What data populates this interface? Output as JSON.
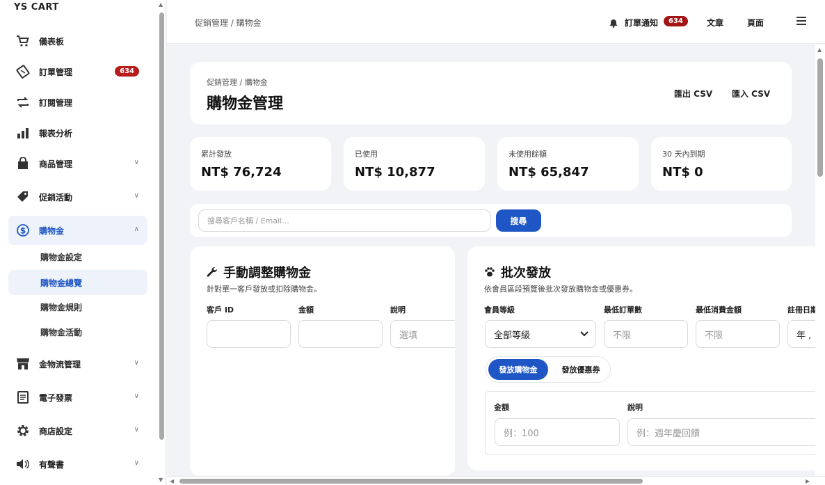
{
  "brand": "YS CART",
  "sidebar": {
    "items": [
      {
        "label": "儀表板",
        "icon": "cart-icon"
      },
      {
        "label": "訂單管理",
        "icon": "receipt-icon",
        "badge": "634"
      },
      {
        "label": "訂閱管理",
        "icon": "repeat-icon"
      },
      {
        "label": "報表分析",
        "icon": "bar-chart-icon"
      },
      {
        "label": "商品管理",
        "icon": "shop-bag-icon"
      },
      {
        "label": "促銷活動",
        "icon": "tag-icon"
      },
      {
        "label": "購物金",
        "icon": "dollar-circle-icon"
      },
      {
        "label": "金物流管理",
        "icon": "store-icon"
      },
      {
        "label": "電子發票",
        "icon": "invoice-icon"
      },
      {
        "label": "商店設定",
        "icon": "gear-icon"
      },
      {
        "label": "有聲書",
        "icon": "speaker-icon"
      }
    ],
    "sub_items": [
      "購物金設定",
      "購物金總覽",
      "購物金規則",
      "購物金活動"
    ]
  },
  "topbar": {
    "breadcrumb": "促銷管理 / 購物金",
    "notify_label": "訂單通知",
    "notify_count": "634",
    "articles": "文章",
    "pages": "頁面"
  },
  "header": {
    "breadcrumb": "促銷管理 / 購物金",
    "title": "購物金管理",
    "export_csv": "匯出 CSV",
    "import_csv": "匯入 CSV"
  },
  "stats": [
    {
      "label": "累計發放",
      "value": "NT$ 76,724"
    },
    {
      "label": "已使用",
      "value": "NT$ 10,877"
    },
    {
      "label": "未使用餘額",
      "value": "NT$ 65,847"
    },
    {
      "label": "30 天內到期",
      "value": "NT$ 0"
    }
  ],
  "search": {
    "placeholder": "搜尋客戶名稱 / Email...",
    "button": "搜尋"
  },
  "manual": {
    "title": "手動調整購物金",
    "desc": "針對單一客戶發放或扣除購物金。",
    "customer_id_label": "客戶 ID",
    "amount_label": "金額",
    "note_label": "說明",
    "note_placeholder": "選填"
  },
  "batch": {
    "title": "批次發放",
    "desc": "依會員區段預覽後批次發放購物金或優惠券。",
    "level_label": "會員等級",
    "level_value": "全部等級",
    "min_orders_label": "最低訂單數",
    "min_orders_placeholder": "不限",
    "min_spend_label": "最低消費金額",
    "min_spend_placeholder": "不限",
    "reg_date_label": "註冊日期",
    "reg_date_value": "年 ,",
    "tab_credit": "發放購物金",
    "tab_coupon": "發放優惠券",
    "amount_label": "金額",
    "amount_placeholder": "例：100",
    "note_label": "說明",
    "note_placeholder": "例：週年慶回饋"
  }
}
